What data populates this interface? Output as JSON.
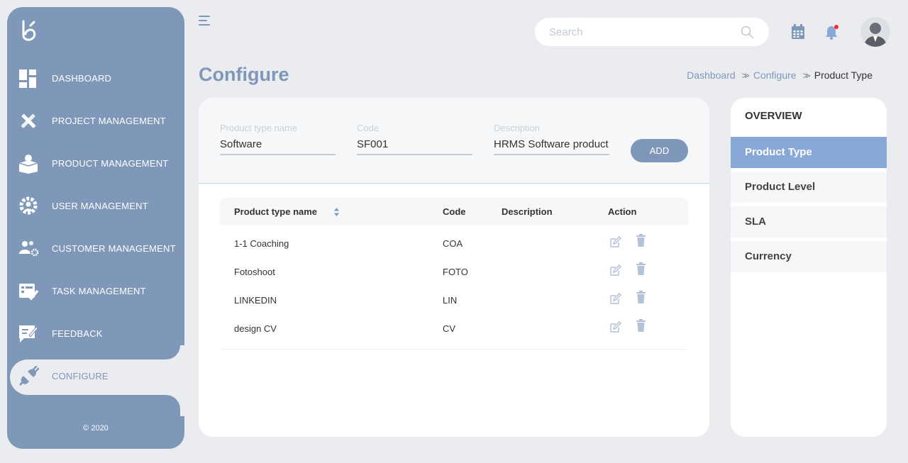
{
  "sidebar": {
    "items": [
      {
        "label": "DASHBOARD",
        "icon": "dashboard-icon"
      },
      {
        "label": "PROJECT MANAGEMENT",
        "icon": "tools-icon"
      },
      {
        "label": "PRODUCT MANAGEMENT",
        "icon": "box-icon"
      },
      {
        "label": "USER MANAGEMENT",
        "icon": "user-gear-icon"
      },
      {
        "label": "CUSTOMER MANAGEMENT",
        "icon": "customers-icon"
      },
      {
        "label": "TASK MANAGEMENT",
        "icon": "task-check-icon"
      },
      {
        "label": "FEEDBACK",
        "icon": "feedback-icon"
      },
      {
        "label": "CONFIGURE",
        "icon": "plug-icon"
      }
    ],
    "active": "CONFIGURE",
    "copyright": "© 2020"
  },
  "topbar": {
    "search_placeholder": "Search"
  },
  "page": {
    "title": "Configure",
    "breadcrumb": [
      "Dashboard",
      "Configure",
      "Product Type"
    ]
  },
  "form": {
    "name_label": "Product type name",
    "name_value": "Software",
    "code_label": "Code",
    "code_value": "SF001",
    "desc_label": "Description",
    "desc_value": "HRMS Software product",
    "add_label": "ADD"
  },
  "table": {
    "headers": [
      "Product type name",
      "Code",
      "Description",
      "Action"
    ],
    "rows": [
      {
        "name": "1-1 Coaching",
        "code": "COA",
        "description": ""
      },
      {
        "name": "Fotoshoot",
        "code": "FOTO",
        "description": ""
      },
      {
        "name": "LINKEDIN",
        "code": "LIN",
        "description": ""
      },
      {
        "name": "design CV",
        "code": "CV",
        "description": ""
      }
    ]
  },
  "panel": {
    "title": "OVERVIEW",
    "items": [
      "Product Type",
      "Product Level",
      "SLA",
      "Currency"
    ],
    "active": "Product Type"
  },
  "colors": {
    "accent": "#7f98b9",
    "active_item": "#88a8d8",
    "background": "#eaecf0",
    "notification_dot": "#ff2a2a"
  }
}
